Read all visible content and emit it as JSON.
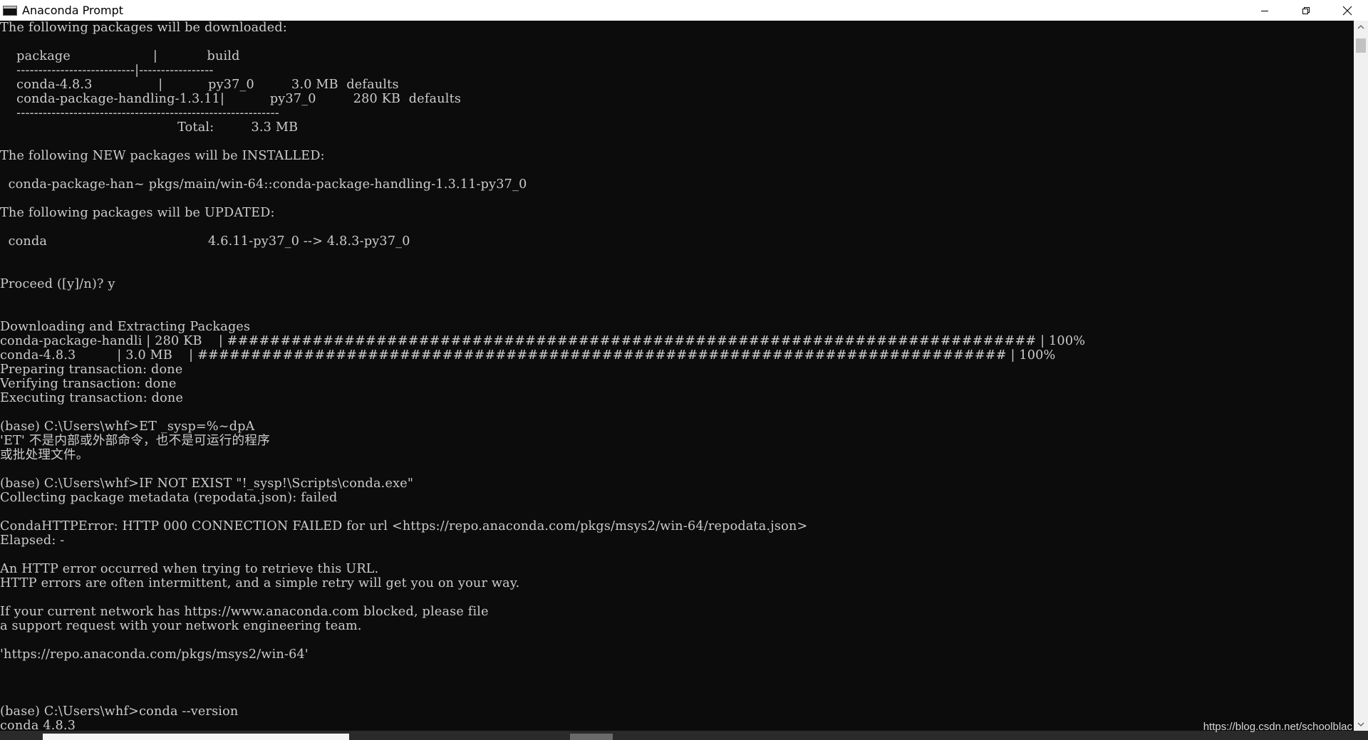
{
  "window": {
    "title": "Anaconda Prompt",
    "icons": {
      "app": "console-icon",
      "minimize": "minimize-icon",
      "restore": "restore-icon",
      "close": "close-icon"
    }
  },
  "colors": {
    "console_bg": "#0c0c0c",
    "console_fg": "#cccccc",
    "titlebar_bg": "#ffffff"
  },
  "console": {
    "lines": [
      "The following packages will be downloaded:",
      "",
      "    package                    |            build",
      "    ---------------------------|-----------------",
      "    conda-4.8.3                |           py37_0         3.0 MB  defaults",
      "    conda-package-handling-1.3.11|           py37_0         280 KB  defaults",
      "    ------------------------------------------------------------",
      "                                           Total:         3.3 MB",
      "",
      "The following NEW packages will be INSTALLED:",
      "",
      "  conda-package-han~ pkgs/main/win-64::conda-package-handling-1.3.11-py37_0",
      "",
      "The following packages will be UPDATED:",
      "",
      "  conda                                       4.6.11-py37_0 --> 4.8.3-py37_0",
      "",
      "",
      "Proceed ([y]/n)? y",
      "",
      "",
      "Downloading and Extracting Packages",
      "conda-package-handli | 280 KB    | ############################################################################ | 100%",
      "conda-4.8.3          | 3.0 MB    | ############################################################################ | 100%",
      "Preparing transaction: done",
      "Verifying transaction: done",
      "Executing transaction: done",
      "",
      "(base) C:\\Users\\whf>ET _sysp=%~dpA",
      "'ET' 不是内部或外部命令，也不是可运行的程序",
      "或批处理文件。",
      "",
      "(base) C:\\Users\\whf>IF NOT EXIST \"!_sysp!\\Scripts\\conda.exe\"",
      "Collecting package metadata (repodata.json): failed",
      "",
      "CondaHTTPError: HTTP 000 CONNECTION FAILED for url <https://repo.anaconda.com/pkgs/msys2/win-64/repodata.json>",
      "Elapsed: -",
      "",
      "An HTTP error occurred when trying to retrieve this URL.",
      "HTTP errors are often intermittent, and a simple retry will get you on your way.",
      "",
      "If your current network has https://www.anaconda.com blocked, please file",
      "a support request with your network engineering team.",
      "",
      "'https://repo.anaconda.com/pkgs/msys2/win-64'",
      "",
      "",
      "",
      "(base) C:\\Users\\whf>conda --version",
      "conda 4.8.3"
    ]
  },
  "watermark": "https://blog.csdn.net/schoolblac"
}
